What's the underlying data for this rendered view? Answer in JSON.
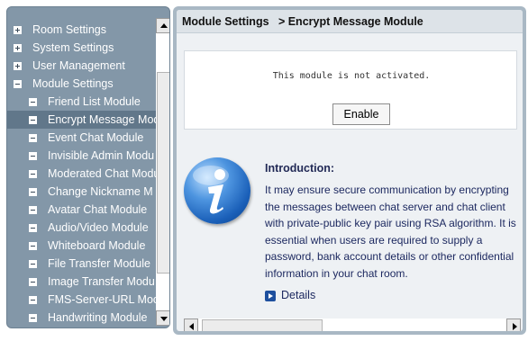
{
  "sidebar": {
    "items": [
      {
        "label": "Room Settings",
        "expander": "plus",
        "level": 0,
        "selected": false
      },
      {
        "label": "System Settings",
        "expander": "plus",
        "level": 0,
        "selected": false
      },
      {
        "label": "User Management",
        "expander": "plus",
        "level": 0,
        "selected": false
      },
      {
        "label": "Module Settings",
        "expander": "minus",
        "level": 0,
        "selected": false
      },
      {
        "label": "Friend List Module",
        "expander": "minus",
        "level": 1,
        "selected": false
      },
      {
        "label": "Encrypt Message Mod",
        "expander": "minus",
        "level": 1,
        "selected": true
      },
      {
        "label": "Event Chat Module",
        "expander": "minus",
        "level": 1,
        "selected": false
      },
      {
        "label": "Invisible Admin Modu",
        "expander": "minus",
        "level": 1,
        "selected": false
      },
      {
        "label": "Moderated Chat Modu",
        "expander": "minus",
        "level": 1,
        "selected": false
      },
      {
        "label": "Change Nickname M",
        "expander": "minus",
        "level": 1,
        "selected": false
      },
      {
        "label": "Avatar Chat Module",
        "expander": "minus",
        "level": 1,
        "selected": false
      },
      {
        "label": "Audio/Video Module",
        "expander": "minus",
        "level": 1,
        "selected": false
      },
      {
        "label": "Whiteboard Module",
        "expander": "minus",
        "level": 1,
        "selected": false
      },
      {
        "label": "File Transfer Module",
        "expander": "minus",
        "level": 1,
        "selected": false
      },
      {
        "label": "Image Transfer Modu",
        "expander": "minus",
        "level": 1,
        "selected": false
      },
      {
        "label": "FMS-Server-URL Moc",
        "expander": "minus",
        "level": 1,
        "selected": false
      },
      {
        "label": "Handwriting Module",
        "expander": "minus",
        "level": 1,
        "selected": false
      }
    ]
  },
  "header": {
    "title": "Module Settings   > Encrypt Message Module"
  },
  "status": {
    "message": "This module is not activated.",
    "enable_label": "Enable"
  },
  "intro": {
    "title": "Introduction:",
    "body": "It may ensure secure communication by encrypting the messages between chat server and chat client with private-public key pair using RSA algorithm. It is essential when users are required to supply a password, bank account details or other confidential information in your chat room.",
    "details_label": "Details"
  },
  "icons": {
    "info": "info-icon",
    "details": "play-icon",
    "expand": "plus-box-icon",
    "collapse": "minus-box-icon"
  },
  "colors": {
    "sidebar_bg": "#8397a8",
    "sidebar_selected": "#61778a",
    "text_link": "#1d2960"
  }
}
